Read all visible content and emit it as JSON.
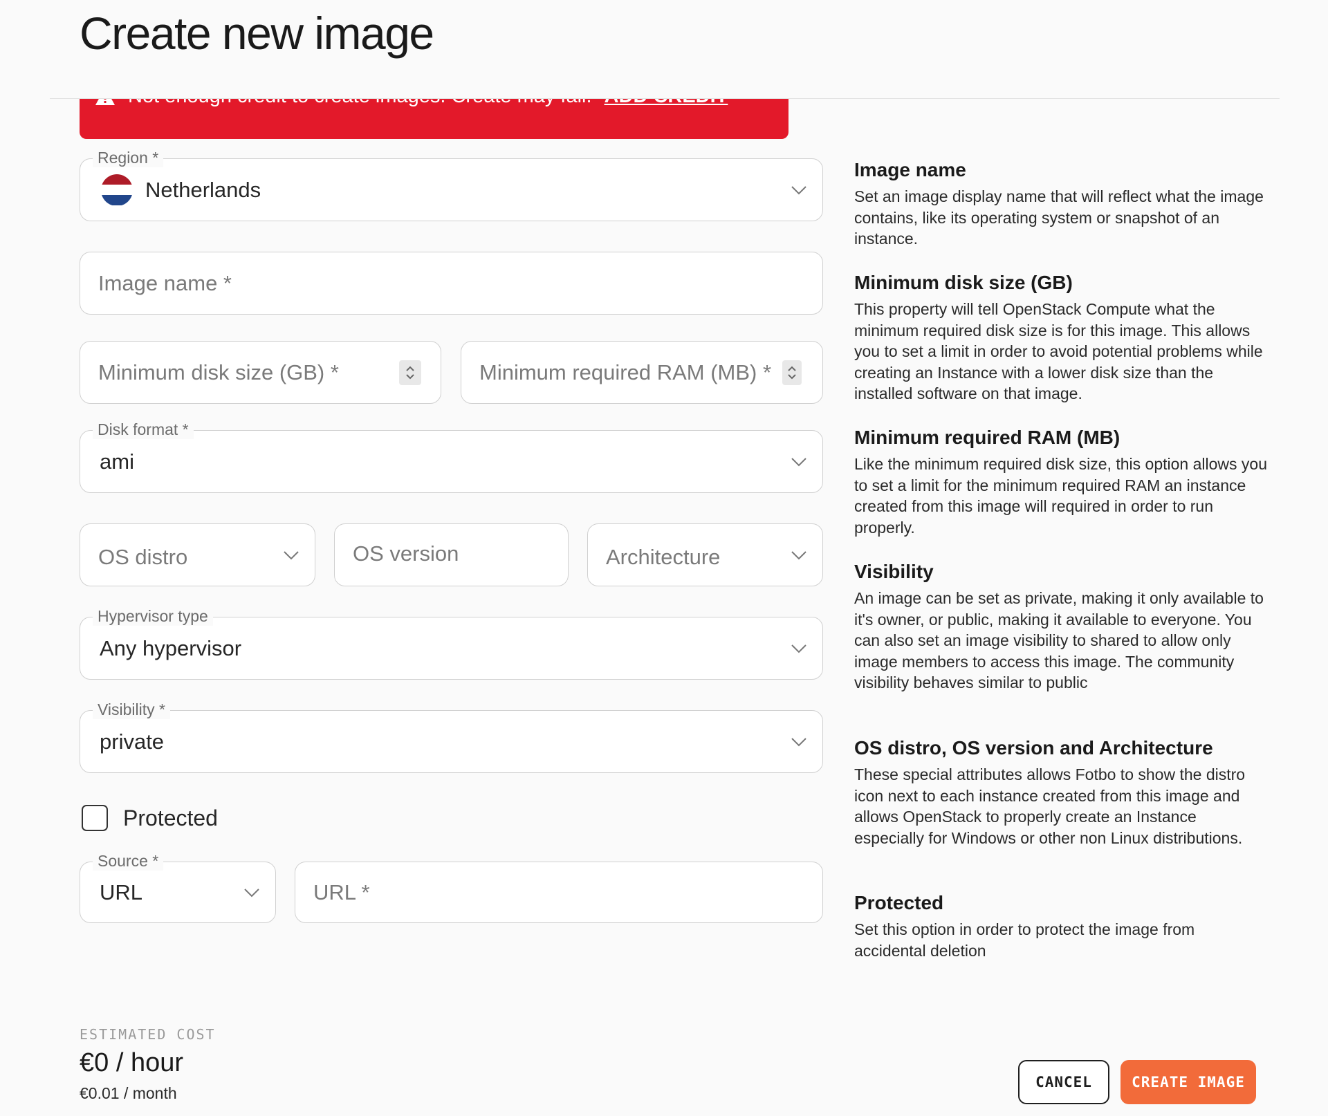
{
  "page": {
    "title": "Create new image"
  },
  "alert": {
    "message": "Not enough credit to create images. Create may fail.",
    "link_label": "ADD CREDIT"
  },
  "form": {
    "region": {
      "label": "Region *",
      "value": "Netherlands",
      "flag_colors": [
        "#ae1c28",
        "#ffffff",
        "#21468b"
      ]
    },
    "image_name": {
      "placeholder": "Image name *"
    },
    "min_disk": {
      "placeholder": "Minimum disk size (GB) *"
    },
    "min_ram": {
      "placeholder": "Minimum required RAM (MB) *"
    },
    "disk_format": {
      "label": "Disk format *",
      "value": "ami"
    },
    "os_distro": {
      "placeholder": "OS distro"
    },
    "os_version": {
      "placeholder": "OS version"
    },
    "architecture": {
      "placeholder": "Architecture"
    },
    "hypervisor": {
      "label": "Hypervisor type",
      "value": "Any hypervisor"
    },
    "visibility": {
      "label": "Visibility *",
      "value": "private"
    },
    "protected": {
      "label": "Protected",
      "checked": false
    },
    "source": {
      "label": "Source *",
      "value": "URL"
    },
    "url": {
      "placeholder": "URL *"
    }
  },
  "help": [
    {
      "title": "Image name",
      "text": "Set an image display name that will reflect what the image contains, like its operating system or snapshot of an instance."
    },
    {
      "title": "Minimum disk size (GB)",
      "text": "This property will tell OpenStack Compute what the minimum required disk size is for this image. This allows you to set a limit in order to avoid potential problems while creating an Instance with a lower disk size than the installed software on that image."
    },
    {
      "title": "Minimum required RAM (MB)",
      "text": "Like the minimum required disk size, this option allows you to set a limit for the minimum required RAM an instance created from this image will required in order to run properly."
    },
    {
      "title": "Visibility",
      "text": "An image can be set as private, making it only available to it's owner, or public, making it available to everyone. You can also set an image visibility to shared to allow only image members to access this image. The community visibility behaves similar to public"
    },
    {
      "title": "OS distro, OS version and Architecture",
      "text": "These special attributes allows Fotbo to show the distro icon next to each instance created from this image and allows OpenStack to properly create an Instance especially for Windows or other non Linux distributions."
    },
    {
      "title": "Protected",
      "text": "Set this option in order to protect the image from accidental deletion"
    }
  ],
  "cost": {
    "label": "ESTIMATED COST",
    "hourly": "€0 / hour",
    "monthly": "€0.01 / month"
  },
  "actions": {
    "cancel_label": "CANCEL",
    "create_label": "CREATE IMAGE"
  },
  "colors": {
    "alert_bg": "#e3192a",
    "primary": "#f26b3a"
  }
}
